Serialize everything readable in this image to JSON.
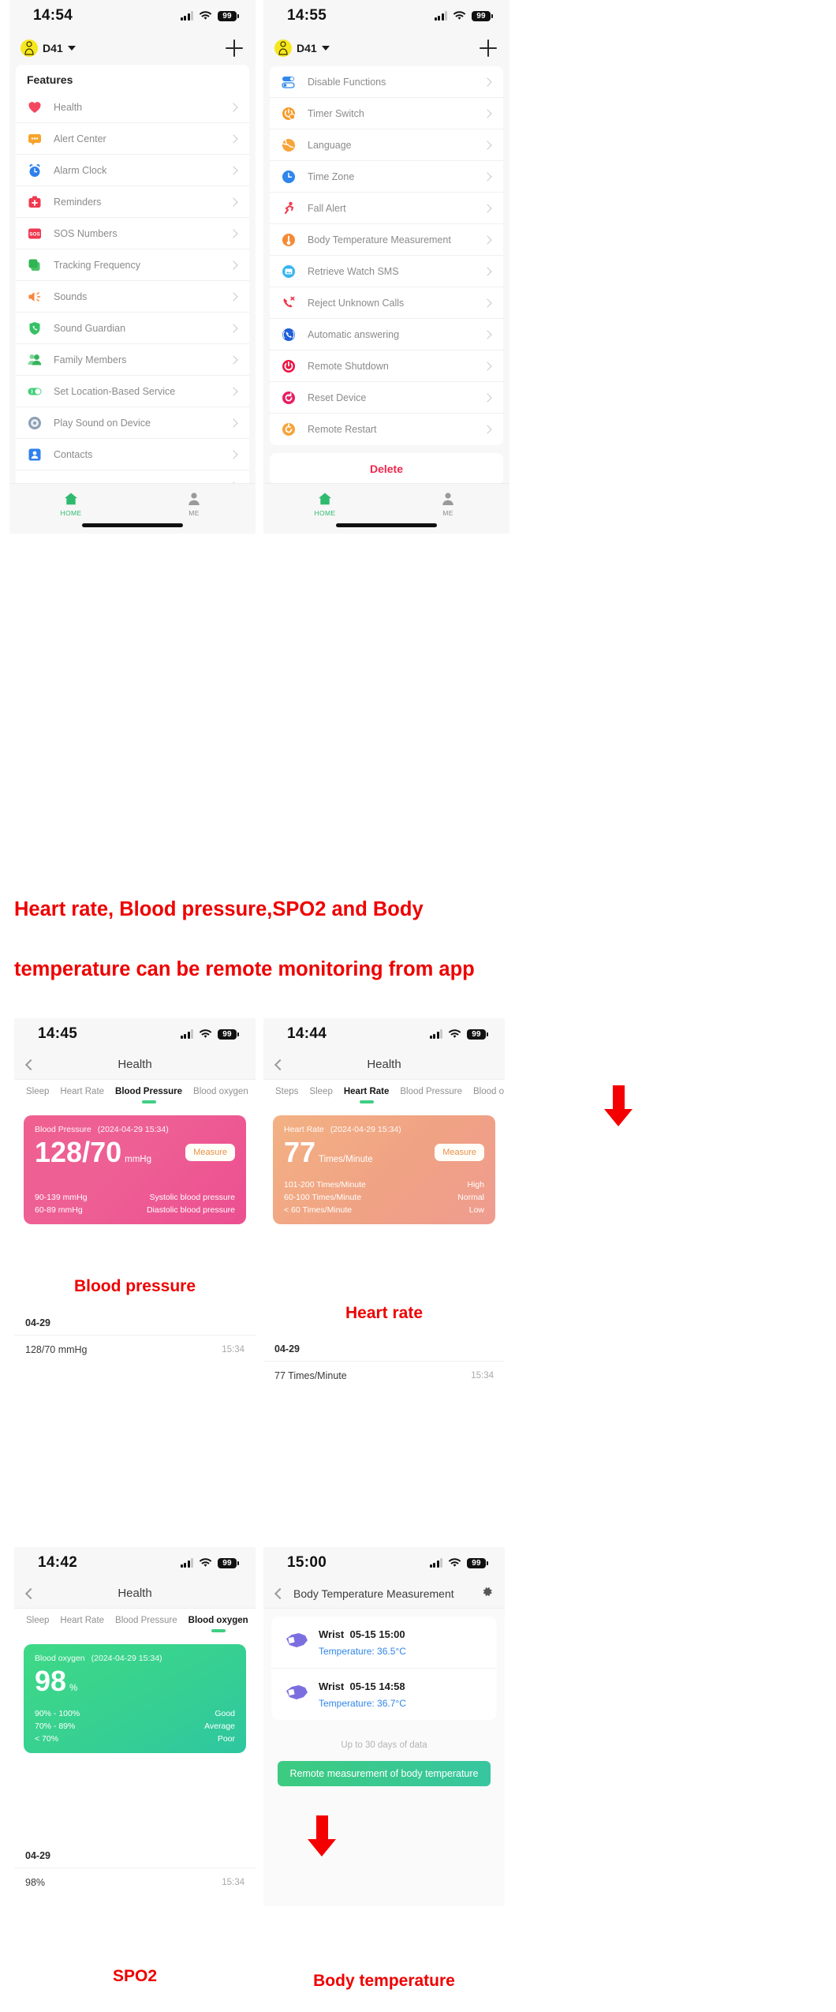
{
  "screens": {
    "features": {
      "status": {
        "time": "14:54",
        "battery": "99"
      },
      "device": "D41",
      "section_title": "Features",
      "items": [
        {
          "label": "Health",
          "icon": "heart-icon"
        },
        {
          "label": "Alert Center",
          "icon": "alert-bubble-icon"
        },
        {
          "label": "Alarm Clock",
          "icon": "alarm-clock-icon"
        },
        {
          "label": "Reminders",
          "icon": "medkit-icon"
        },
        {
          "label": "SOS Numbers",
          "icon": "sos-icon"
        },
        {
          "label": "Tracking Frequency",
          "icon": "layers-icon"
        },
        {
          "label": "Sounds",
          "icon": "speaker-icon"
        },
        {
          "label": "Sound Guardian",
          "icon": "shield-phone-icon"
        },
        {
          "label": "Family Members",
          "icon": "family-icon"
        },
        {
          "label": "Set Location-Based Service",
          "icon": "toggle-location-icon"
        },
        {
          "label": "Play Sound on Device",
          "icon": "play-sound-icon"
        },
        {
          "label": "Contacts",
          "icon": "contacts-icon"
        }
      ],
      "tabs": [
        {
          "label": "HOME",
          "icon": "home-icon",
          "active": true
        },
        {
          "label": "ME",
          "icon": "person-icon",
          "active": false
        }
      ]
    },
    "settings": {
      "status": {
        "time": "14:55",
        "battery": "99"
      },
      "device": "D41",
      "items": [
        {
          "label": "Disable Functions",
          "icon": "toggles-icon"
        },
        {
          "label": "Timer Switch",
          "icon": "power-timer-icon"
        },
        {
          "label": "Language",
          "icon": "globe-icon"
        },
        {
          "label": "Time Zone",
          "icon": "clock-icon"
        },
        {
          "label": "Fall Alert",
          "icon": "falling-person-icon"
        },
        {
          "label": "Body Temperature Measurement",
          "icon": "thermometer-icon"
        },
        {
          "label": "Retrieve Watch SMS",
          "icon": "sms-image-icon"
        },
        {
          "label": "Reject Unknown Calls",
          "icon": "phone-reject-icon"
        },
        {
          "label": "Automatic answering",
          "icon": "phone-auto-icon"
        },
        {
          "label": "Remote Shutdown",
          "icon": "power-icon"
        },
        {
          "label": "Reset Device",
          "icon": "reset-icon"
        },
        {
          "label": "Remote Restart",
          "icon": "restart-icon"
        }
      ],
      "delete_label": "Delete",
      "tabs": [
        {
          "label": "HOME",
          "icon": "home-icon",
          "active": true
        },
        {
          "label": "ME",
          "icon": "person-icon",
          "active": false
        }
      ]
    },
    "blood_pressure": {
      "status": {
        "time": "14:45",
        "battery": "99"
      },
      "nav_title": "Health",
      "tabs": [
        "Sleep",
        "Heart Rate",
        "Blood Pressure",
        "Blood oxygen"
      ],
      "active_tab": "Blood Pressure",
      "card": {
        "title": "Blood Pressure",
        "timestamp": "(2024-04-29 15:34)",
        "value": "128/70",
        "unit": "mmHg",
        "measure_label": "Measure",
        "legend": [
          {
            "range": "90-139 mmHg",
            "note": "Systolic blood pressure"
          },
          {
            "range": "60-89 mmHg",
            "note": "Diastolic blood pressure"
          }
        ]
      },
      "history_date": "04-29",
      "history": [
        {
          "value": "128/70 mmHg",
          "time": "15:34"
        }
      ],
      "caption": "Blood pressure"
    },
    "heart_rate": {
      "status": {
        "time": "14:44",
        "battery": "99"
      },
      "nav_title": "Health",
      "tabs": [
        "Steps",
        "Sleep",
        "Heart Rate",
        "Blood Pressure",
        "Blood o"
      ],
      "active_tab": "Heart Rate",
      "card": {
        "title": "Heart Rate",
        "timestamp": "(2024-04-29 15:34)",
        "value": "77",
        "unit": "Times/Minute",
        "measure_label": "Measure",
        "legend": [
          {
            "range": "101-200 Times/Minute",
            "note": "High"
          },
          {
            "range": "60-100 Times/Minute",
            "note": "Normal"
          },
          {
            "range": "< 60 Times/Minute",
            "note": "Low"
          }
        ]
      },
      "history_date": "04-29",
      "history": [
        {
          "value": "77 Times/Minute",
          "time": "15:34"
        }
      ],
      "caption": "Heart rate"
    },
    "blood_oxygen": {
      "status": {
        "time": "14:42",
        "battery": "99"
      },
      "nav_title": "Health",
      "tabs": [
        "Sleep",
        "Heart Rate",
        "Blood Pressure",
        "Blood oxygen"
      ],
      "active_tab": "Blood oxygen",
      "card": {
        "title": "Blood oxygen",
        "timestamp": "(2024-04-29 15:34)",
        "value": "98",
        "unit": "%",
        "legend": [
          {
            "range": "90% - 100%",
            "note": "Good"
          },
          {
            "range": "70% - 89%",
            "note": "Average"
          },
          {
            "range": "< 70%",
            "note": "Poor"
          }
        ]
      },
      "history_date": "04-29",
      "history": [
        {
          "value": "98%",
          "time": "15:34"
        }
      ],
      "caption": "SPO2"
    },
    "body_temperature": {
      "status": {
        "time": "15:00",
        "battery": "99"
      },
      "nav_title": "Body Temperature Measurement",
      "records": [
        {
          "place": "Wrist",
          "when": "05-15 15:00",
          "temp": "Temperature: 36.5°C",
          "icon": "wrist-sensor-icon"
        },
        {
          "place": "Wrist",
          "when": "05-15 14:58",
          "temp": "Temperature: 36.7°C",
          "icon": "wrist-sensor-icon"
        }
      ],
      "note": "Up to 30 days of data",
      "button_label": "Remote measurement of body temperature",
      "caption": "Body temperature"
    }
  },
  "headline": {
    "line1": "Heart rate, Blood pressure,SPO2 and Body",
    "line2": "temperature can be remote monitoring from app"
  },
  "colors": {
    "red": "#ee0000",
    "green": "#3fce84",
    "blue": "#2f86e8"
  }
}
